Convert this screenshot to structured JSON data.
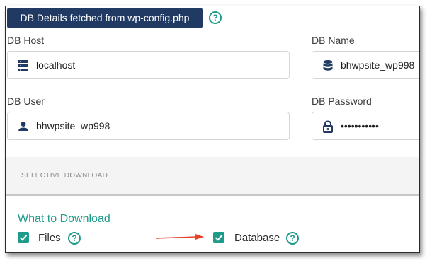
{
  "fetch_banner": {
    "label": "DB Details fetched from wp-config.php"
  },
  "db_host": {
    "label": "DB Host",
    "value": "localhost",
    "icon": "server-icon"
  },
  "db_name": {
    "label": "DB Name",
    "value": "bhwpsite_wp998",
    "icon": "database-icon"
  },
  "db_user": {
    "label": "DB User",
    "value": "bhwpsite_wp998",
    "icon": "person-icon"
  },
  "db_password": {
    "label": "DB Password",
    "value": "•••••••••••",
    "icon": "lock-icon"
  },
  "selective_download": {
    "title": "SELECTIVE DOWNLOAD"
  },
  "what_to_download": {
    "title": "What to Download",
    "options": [
      {
        "label": "Files",
        "checked": true
      },
      {
        "label": "Database",
        "checked": true
      }
    ]
  },
  "help_glyph": "?",
  "colors": {
    "accent": "#1f9b89",
    "banner_bg": "#213a63",
    "arrow": "#e8432a"
  }
}
